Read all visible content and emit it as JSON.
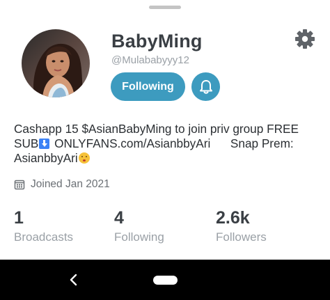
{
  "profile": {
    "display_name": "BabyMing",
    "handle": "@Mulababyyy12",
    "follow_label": "Following",
    "bio_line1": "Cashapp 15 $AsianBabyMing to join priv group FREE",
    "bio_line2_a": "SUB",
    "bio_line2_b": " ONLYFANS.com/AsianbbyAri      Snap Prem:",
    "bio_line3": "AsianbbyAri",
    "joined": "Joined Jan 2021"
  },
  "stats": [
    {
      "value": "1",
      "label": "Broadcasts"
    },
    {
      "value": "4",
      "label": "Following"
    },
    {
      "value": "2.6k",
      "label": "Followers"
    }
  ],
  "icons": {
    "settings": "gear-icon",
    "notifications": "bell-icon",
    "calendar": "calendar-icon",
    "back": "back-icon",
    "home": "home-pill"
  },
  "colors": {
    "accent": "#3d9bbf",
    "name_text": "#3a3f44",
    "muted_text": "#9aa0a6",
    "nav_bar": "#000000"
  }
}
